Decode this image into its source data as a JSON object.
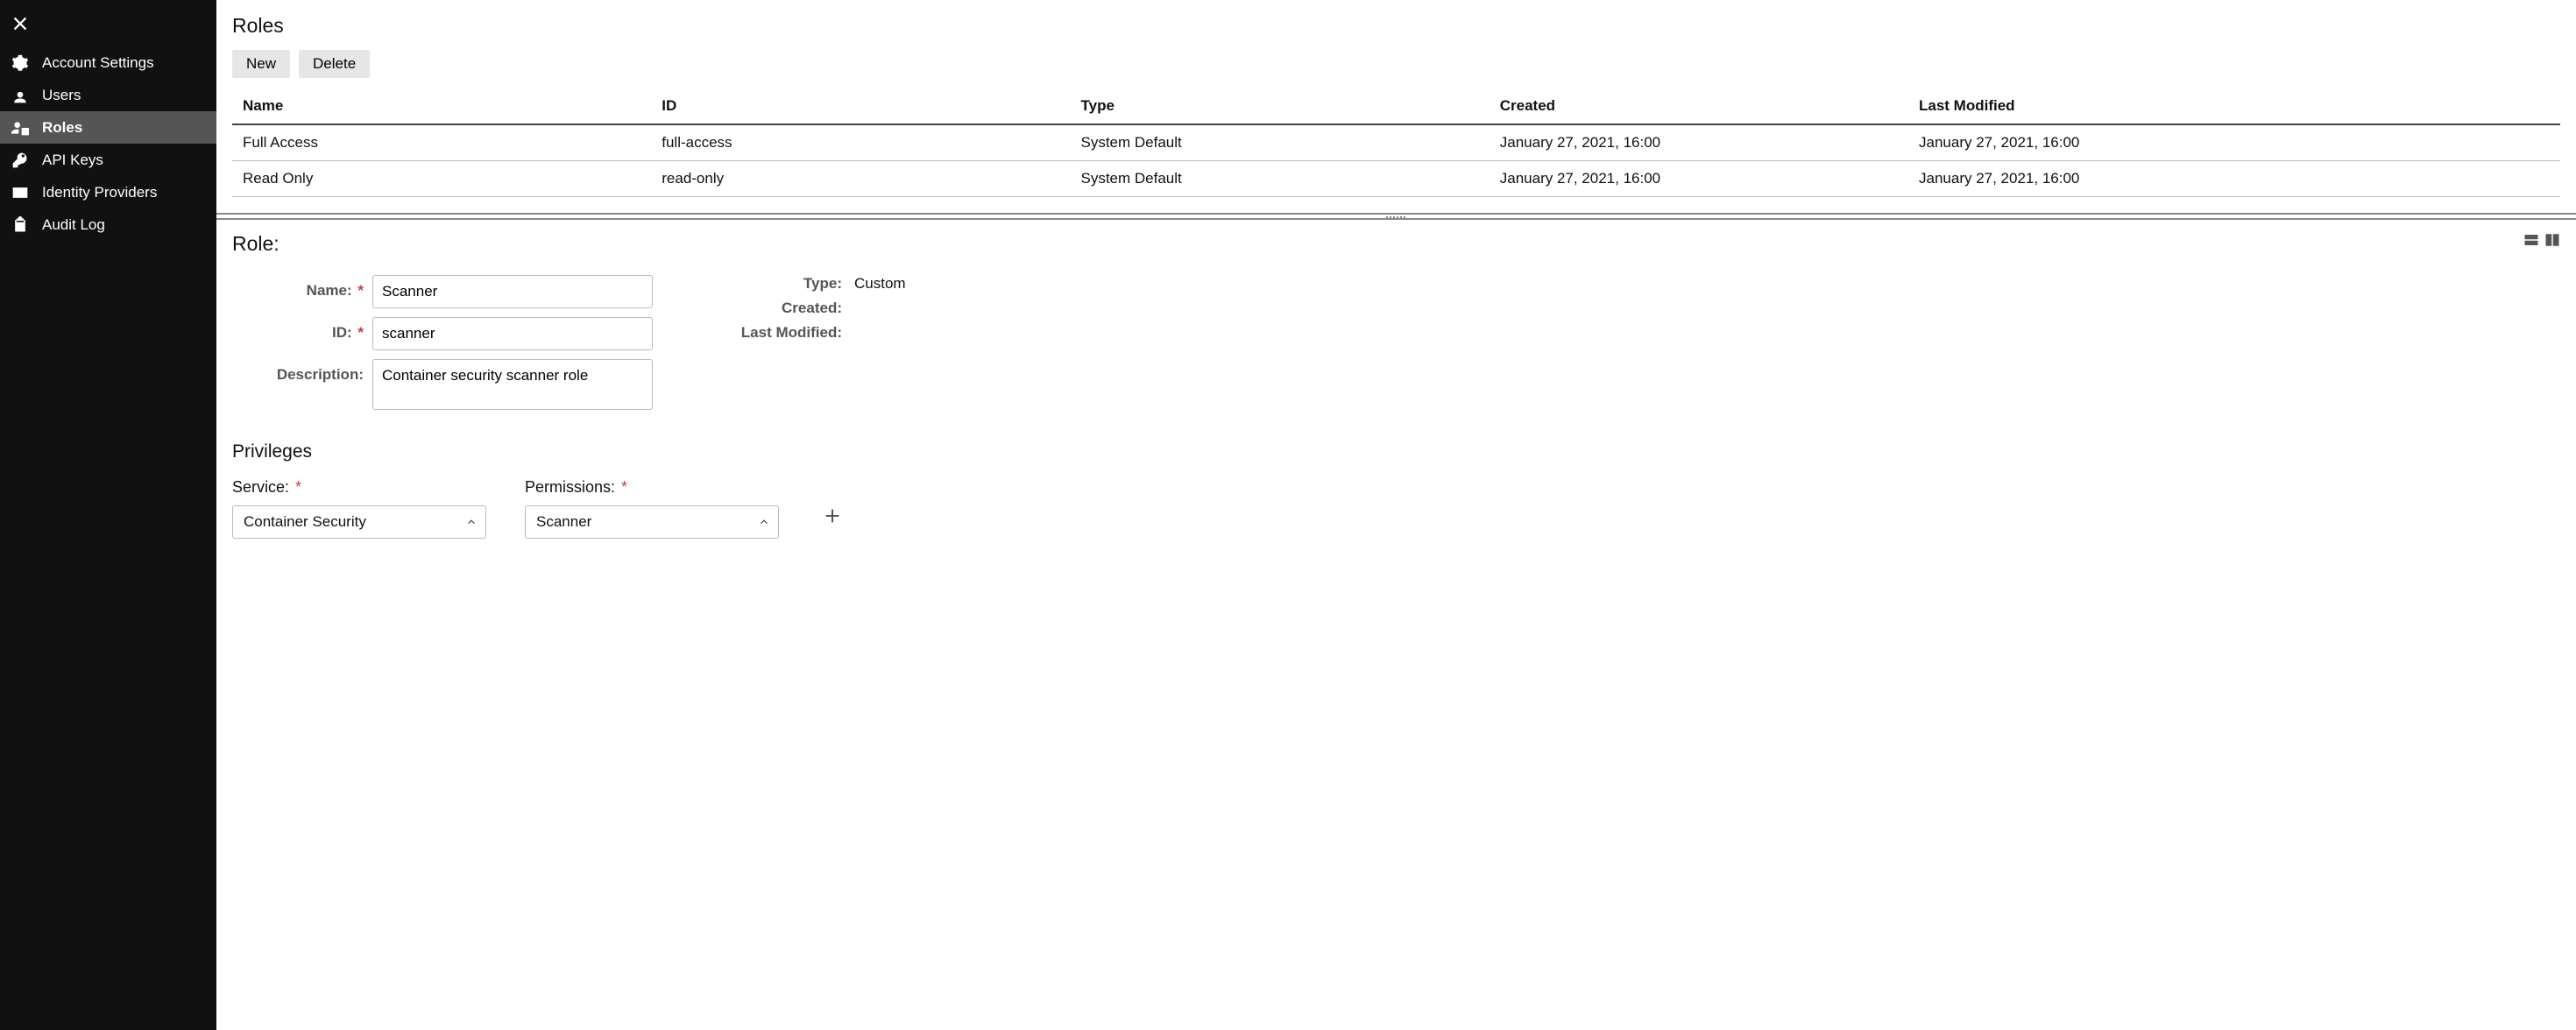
{
  "sidebar": {
    "items": [
      {
        "label": "Account Settings"
      },
      {
        "label": "Users"
      },
      {
        "label": "Roles"
      },
      {
        "label": "API Keys"
      },
      {
        "label": "Identity Providers"
      },
      {
        "label": "Audit Log"
      }
    ]
  },
  "page": {
    "title": "Roles",
    "buttons": {
      "new": "New",
      "delete": "Delete"
    }
  },
  "table": {
    "headers": {
      "name": "Name",
      "id": "ID",
      "type": "Type",
      "created": "Created",
      "modified": "Last Modified"
    },
    "rows": [
      {
        "name": "Full Access",
        "id": "full-access",
        "type": "System Default",
        "created": "January 27, 2021, 16:00",
        "modified": "January 27, 2021, 16:00"
      },
      {
        "name": "Read Only",
        "id": "read-only",
        "type": "System Default",
        "created": "January 27, 2021, 16:00",
        "modified": "January 27, 2021, 16:00"
      }
    ]
  },
  "detail": {
    "title": "Role:",
    "labels": {
      "name": "Name:",
      "id": "ID:",
      "description": "Description:",
      "type": "Type:",
      "created": "Created:",
      "modified": "Last Modified:"
    },
    "values": {
      "name": "Scanner",
      "id": "scanner",
      "description": "Container security scanner role",
      "type": "Custom",
      "created": "",
      "modified": ""
    }
  },
  "privileges": {
    "title": "Privileges",
    "service_label": "Service:",
    "permissions_label": "Permissions:",
    "service_value": "Container Security",
    "permissions_value": "Scanner"
  }
}
